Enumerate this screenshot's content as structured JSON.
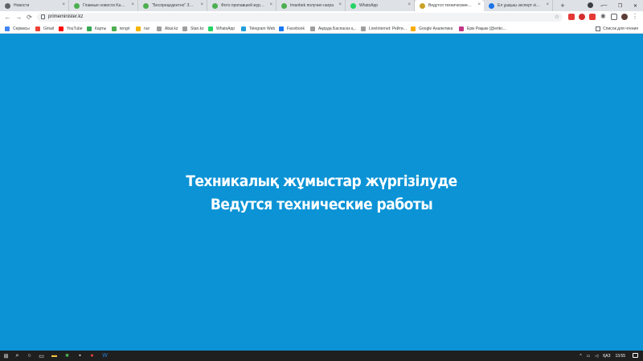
{
  "browser": {
    "tabs": [
      {
        "title": "Новости",
        "icon": "globe-icon",
        "color": "#5f6368",
        "active": false
      },
      {
        "title": "Главные новости Kazakhstan",
        "icon": "news-icon",
        "color": "#4caf50",
        "active": false
      },
      {
        "title": "\"Беспрецедентно\" Запад",
        "icon": "news-icon",
        "color": "#4caf50",
        "active": false
      },
      {
        "title": "Фото пропавшей журбоя",
        "icon": "news-icon",
        "color": "#4caf50",
        "active": false
      },
      {
        "title": "Imanbek получил награ",
        "icon": "news-icon",
        "color": "#4caf50",
        "active": false
      },
      {
        "title": "WhatsApp",
        "icon": "whatsapp-icon",
        "color": "#25d366",
        "active": false
      },
      {
        "title": "Ведутся технические раб",
        "icon": "emblem-icon",
        "color": "#c9a227",
        "active": true
      },
      {
        "title": "Ел ұшқыш эксперт кідеп",
        "icon": "chart-icon",
        "color": "#1a73e8",
        "active": false
      }
    ],
    "new_tab_label": "+",
    "url": "primeminister.kz",
    "bookmarks": [
      {
        "label": "Сервисы",
        "color": "#4285f4"
      },
      {
        "label": "Gmail",
        "color": "#ea4335"
      },
      {
        "label": "YouTube",
        "color": "#ff0000"
      },
      {
        "label": "Карты",
        "color": "#34a853"
      },
      {
        "label": "tengri",
        "color": "#4caf50"
      },
      {
        "label": "nur",
        "color": "#f4b400"
      },
      {
        "label": "Abai.kz",
        "color": "#9e9e9e"
      },
      {
        "label": "Stan.kz",
        "color": "#9e9e9e"
      },
      {
        "label": "WhatsApp",
        "color": "#25d366"
      },
      {
        "label": "Telegram Web",
        "color": "#229ed9"
      },
      {
        "label": "Facebook",
        "color": "#1877f2"
      },
      {
        "label": "Ақорда Баспасөз қ...",
        "color": "#9e9e9e"
      },
      {
        "label": "LiveInternet: Рейти...",
        "color": "#9e9e9e"
      },
      {
        "label": "Google Аналитика",
        "color": "#f9ab00"
      },
      {
        "label": "Ерік Рақым (@erikc...",
        "color": "#c13584"
      }
    ],
    "reading_list_label": "Список для чтения"
  },
  "page": {
    "background": "#0b93d6",
    "headline_kk": "Техникалық жұмыстар жүргізілуде",
    "headline_ru": "Ведутся технические работы"
  },
  "taskbar": {
    "language": "ҚАЗ",
    "time": "13:55"
  }
}
